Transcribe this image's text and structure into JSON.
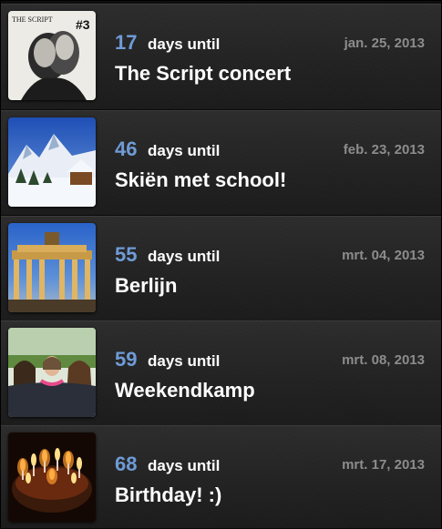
{
  "events": [
    {
      "count": "17",
      "until_label": "days until",
      "date": "jan. 25, 2013",
      "title": "The Script concert",
      "thumb_badge": "#3",
      "thumb_logo": "THE SCRIPT"
    },
    {
      "count": "46",
      "until_label": "days until",
      "date": "feb. 23, 2013",
      "title": "Skiën met school!"
    },
    {
      "count": "55",
      "until_label": "days until",
      "date": "mrt. 04, 2013",
      "title": "Berlijn"
    },
    {
      "count": "59",
      "until_label": "days until",
      "date": "mrt. 08, 2013",
      "title": "Weekendkamp"
    },
    {
      "count": "68",
      "until_label": "days until",
      "date": "mrt. 17, 2013",
      "title": "Birthday! :)"
    }
  ],
  "colors": {
    "count": "#6f9bd6",
    "date": "#8c8c8c",
    "title": "#ffffff",
    "row_bg": "#252525"
  }
}
